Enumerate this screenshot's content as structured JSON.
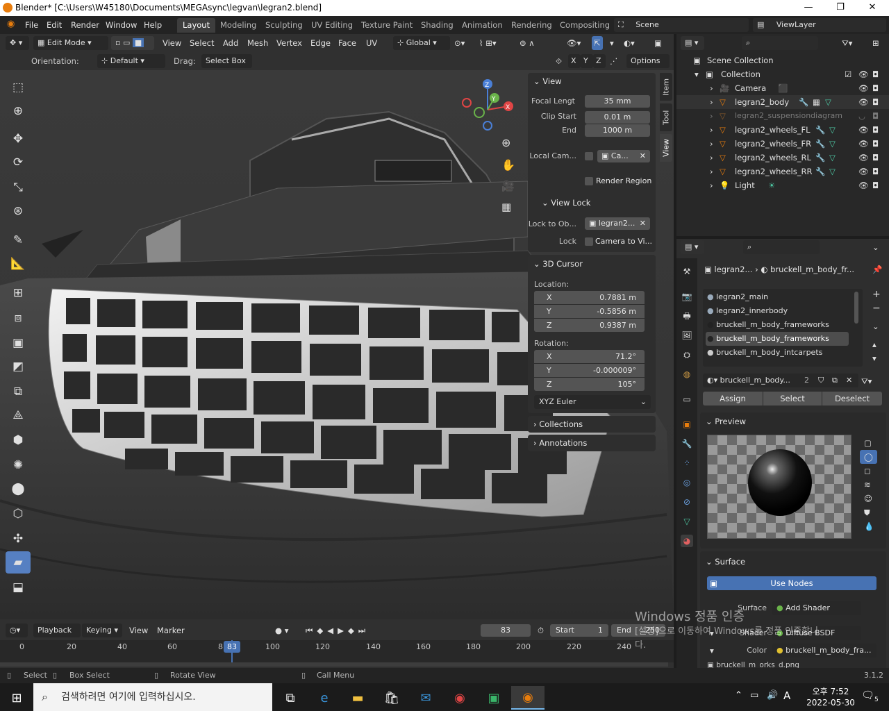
{
  "window": {
    "title": "Blender* [C:\\Users\\W45180\\Documents\\MEGAsync\\legvan\\legran2.blend]",
    "minimize": "—",
    "maximize": "❐",
    "close": "✕"
  },
  "menus": [
    "File",
    "Edit",
    "Render",
    "Window",
    "Help"
  ],
  "workspaces": [
    "Layout",
    "Modeling",
    "Sculpting",
    "UV Editing",
    "Texture Paint",
    "Shading",
    "Animation",
    "Rendering",
    "Compositing"
  ],
  "scene": "Scene",
  "view_layer": "ViewLayer",
  "viewport_header": {
    "mode": "Edit Mode",
    "menus": [
      "View",
      "Select",
      "Add",
      "Mesh",
      "Vertex",
      "Edge",
      "Face",
      "UV"
    ],
    "transform_orientation": "Global",
    "axes": [
      "X",
      "Y",
      "Z"
    ],
    "options": "Options"
  },
  "tool_options": {
    "orientation_label": "Orientation:",
    "orientation": "Default",
    "drag_label": "Drag:",
    "drag": "Select Box"
  },
  "gizmo": {
    "z": "Z",
    "y": "Y",
    "x": "X"
  },
  "npanel": {
    "tabs": [
      "Item",
      "Tool",
      "View"
    ],
    "view": {
      "title": "View",
      "focal_label": "Focal Lengt",
      "focal": "35 mm",
      "clip_start_label": "Clip Start",
      "clip_start": "0.01 m",
      "end_label": "End",
      "end": "1000 m",
      "local_cam_label": "Local Cam...",
      "local_cam": "Ca...",
      "render_region": "Render Region"
    },
    "view_lock": {
      "title": "View Lock",
      "lock_obj_label": "Lock to Ob...",
      "lock_obj": "legran2...",
      "lock_label": "Lock",
      "lock": "Camera to Vi..."
    },
    "cursor": {
      "title": "3D Cursor",
      "location_label": "Location:",
      "loc": [
        {
          "axis": "X",
          "value": "0.7881 m"
        },
        {
          "axis": "Y",
          "value": "-0.5856 m"
        },
        {
          "axis": "Z",
          "value": "0.9387 m"
        }
      ],
      "rotation_label": "Rotation:",
      "rot": [
        {
          "axis": "X",
          "value": "71.2°"
        },
        {
          "axis": "Y",
          "value": "-0.000009°"
        },
        {
          "axis": "Z",
          "value": "105°"
        }
      ],
      "mode": "XYZ Euler"
    },
    "collections": "Collections",
    "annotations": "Annotations"
  },
  "outliner": {
    "scene_collection": "Scene Collection",
    "collection": "Collection",
    "items": [
      "Camera",
      "legran2_body",
      "legran2_suspensiondiagram",
      "legran2_wheels_FL",
      "legran2_wheels_FR",
      "legran2_wheels_RL",
      "legran2_wheels_RR",
      "Light"
    ]
  },
  "properties": {
    "breadcrumb_object": "legran2...",
    "breadcrumb_material": "bruckell_m_body_fr...",
    "slots": [
      "legran2_main",
      "legran2_innerbody",
      "bruckell_m_body_frameworks",
      "bruckell_m_body_frameworks",
      "bruckell_m_body_intcarpets"
    ],
    "material_name": "bruckell_m_body...",
    "users": "2",
    "assign": "Assign",
    "select": "Select",
    "deselect": "Deselect",
    "preview": "Preview",
    "surface": "Surface",
    "use_nodes": "Use Nodes",
    "surface_label": "Surface",
    "surface_value": "Add Shader",
    "shader_label": "Shader",
    "shader_value": "Diffuse BSDF",
    "color_label": "Color",
    "color_value": "bruckell_m_body_fra...",
    "image": "bruckell_m_orks_d.png"
  },
  "timeline": {
    "menus": [
      "Playback",
      "Keying",
      "View",
      "Marker"
    ],
    "current_frame": "83",
    "start_label": "Start",
    "start": "1",
    "end_label": "End",
    "end": "250",
    "ticks": [
      "0",
      "20",
      "40",
      "60",
      "8",
      "100",
      "120",
      "140",
      "160",
      "180",
      "200",
      "220",
      "240"
    ],
    "playhead": "83",
    "playhead_fraction": 0.332
  },
  "statusbar": {
    "select": "Select",
    "box_select": "Box Select",
    "rotate": "Rotate View",
    "call_menu": "Call Menu",
    "version": "3.1.2"
  },
  "watermark": {
    "line1": "Windows 정품 인증",
    "line2": "[설정]으로 이동하여 Windows를 정품 인증합니",
    "line3": "다."
  },
  "taskbar": {
    "search": "검색하려면 여기에 입력하십시오.",
    "time": "오후 7:52",
    "date": "2022-05-30",
    "lang": "A",
    "notif": "5"
  },
  "colors": {
    "accent": "#5680c2",
    "active_blue": "#4772b3",
    "orange": "#e87d0d",
    "x_axis": "#e04545",
    "y_axis": "#6ab34a",
    "z_axis": "#4a7fd6"
  }
}
